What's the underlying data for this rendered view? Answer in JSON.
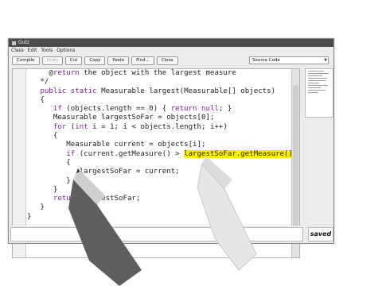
{
  "window": {
    "title": "Gutz"
  },
  "menu": [
    "Class",
    "Edit",
    "Tools",
    "Options"
  ],
  "toolbar": {
    "buttons": [
      "Compile",
      "Undo",
      "Cut",
      "Copy",
      "Paste",
      "Find...",
      "Close"
    ],
    "view_select": "Source Code"
  },
  "editor": {
    "lines": [
      "     @return the object with the largest measure",
      "   */",
      "   public static Measurable largest(Measurable[] objects)",
      "   {",
      "      if (objects.length == 0) { return null; }",
      "      Measurable largestSoFar = objects[0];",
      "      for (int i = 1; i < objects.length; i++)",
      "      {",
      "         Measurable current = objects[i];",
      "         if (current.getMeasure() > largestSoFar.getMeasure())",
      "         {",
      "            largestSoFar = current;",
      "         }",
      "      }",
      "      return largestSoFar;",
      "   }",
      "}"
    ],
    "highlight": "largestSoFar.getMeasure()"
  },
  "status": {
    "message": "",
    "saved": "saved"
  },
  "colors": {
    "highlight": "#ffee00",
    "keyword": "#7a1f8f"
  }
}
